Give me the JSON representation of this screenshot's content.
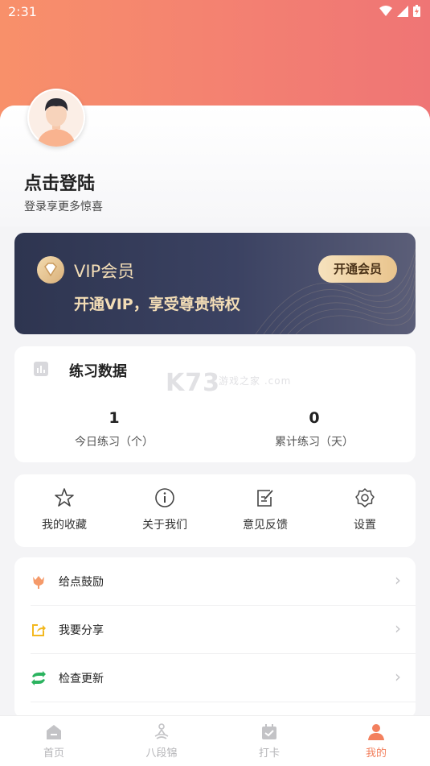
{
  "status_bar": {
    "time": "2:31"
  },
  "profile": {
    "title": "点击登陆",
    "subtitle": "登录享更多惊喜"
  },
  "vip": {
    "title": "VIP会员",
    "subtitle": "开通VIP，享受尊贵特权",
    "button_label": "开通会员",
    "accent_color": "#f3ddb6"
  },
  "practice": {
    "title": "练习数据",
    "stats": [
      {
        "value": "1",
        "label": "今日练习（个）"
      },
      {
        "value": "0",
        "label": "累计练习（天）"
      }
    ]
  },
  "watermark": {
    "brand": "K73",
    "tagline": "游戏之家",
    "domain": ".com"
  },
  "quick_actions": [
    {
      "icon": "star-icon",
      "label": "我的收藏"
    },
    {
      "icon": "info-icon",
      "label": "关于我们"
    },
    {
      "icon": "edit-icon",
      "label": "意见反馈"
    },
    {
      "icon": "gear-icon",
      "label": "设置"
    }
  ],
  "menu": [
    {
      "icon": "tulip-icon",
      "label": "给点鼓励"
    },
    {
      "icon": "share-icon",
      "label": "我要分享"
    },
    {
      "icon": "refresh-icon",
      "label": "检查更新"
    }
  ],
  "tabs": [
    {
      "icon": "home-icon",
      "label": "首页",
      "active": false
    },
    {
      "icon": "meditation-icon",
      "label": "八段锦",
      "active": false
    },
    {
      "icon": "calendar-check-icon",
      "label": "打卡",
      "active": false
    },
    {
      "icon": "person-icon",
      "label": "我的",
      "active": true
    }
  ],
  "colors": {
    "hero_start": "#f8906a",
    "hero_end": "#ef7575",
    "active_tab": "#f3805e"
  }
}
